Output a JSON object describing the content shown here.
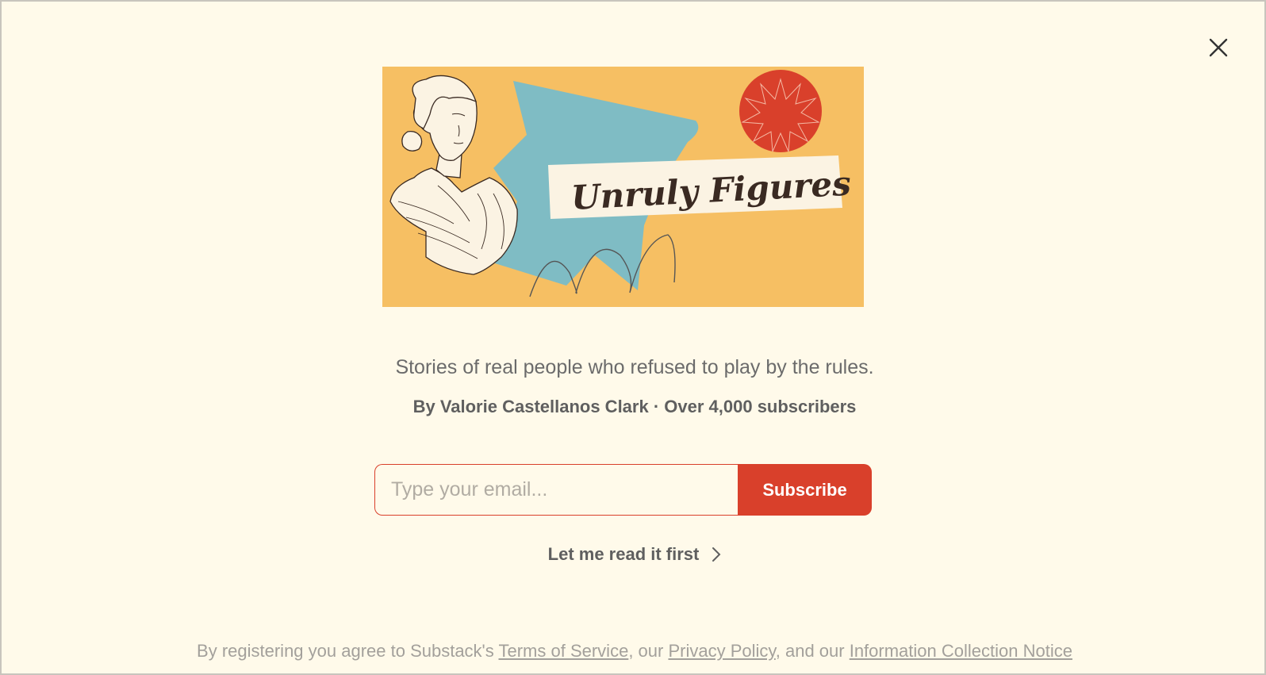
{
  "modal": {
    "close_icon": "close-icon",
    "banner": {
      "logo_text": "Unruly Figures",
      "colors": {
        "background": "#f6bf63",
        "blue": "#7fbcc4",
        "sun": "#d9402b",
        "ink": "#3a2a22"
      }
    },
    "tagline": "Stories of real people who refused to play by the rules.",
    "byline": "By Valorie Castellanos Clark · Over 4,000 subscribers",
    "signup": {
      "email_placeholder": "Type your email...",
      "email_value": "",
      "subscribe_label": "Subscribe"
    },
    "read_first": {
      "label": "Let me read it first",
      "icon": "chevron-right-icon"
    },
    "legal": {
      "prefix": "By registering you agree to Substack's ",
      "terms": "Terms of Service",
      "sep1": ", our ",
      "privacy": "Privacy Policy",
      "sep2": ", and our ",
      "notice": "Information Collection Notice"
    },
    "colors": {
      "accent": "#d9402b",
      "background": "#fffaea",
      "text": "#6b6b6b"
    }
  }
}
